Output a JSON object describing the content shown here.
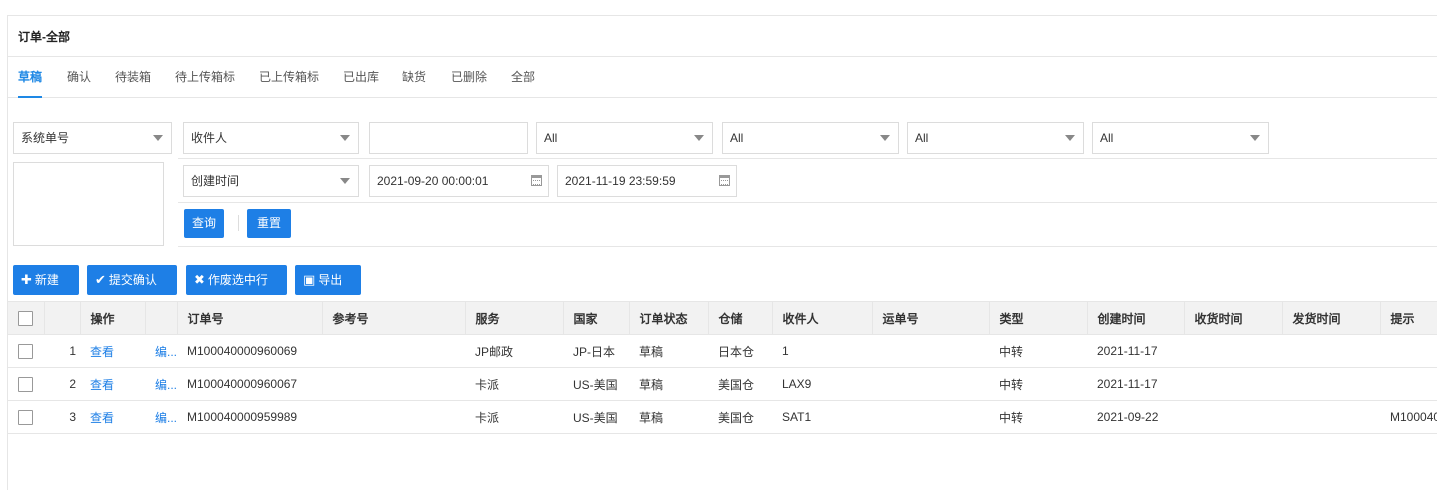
{
  "page": {
    "title": "订单-全部"
  },
  "tabs": [
    "草稿",
    "确认",
    "待装箱",
    "待上传箱标",
    "已上传箱标",
    "已出库",
    "缺货",
    "已删除",
    "全部"
  ],
  "filters": {
    "field_select": "系统单号",
    "receiver_select": "收件人",
    "search_value": "",
    "select3": "All",
    "select4": "All",
    "select5": "All",
    "select6": "All",
    "time_select": "创建时间",
    "start_time": "2021-09-20 00:00:01",
    "end_time": "2021-11-19 23:59:59",
    "query_label": "查询",
    "reset_label": "重置"
  },
  "toolbar": {
    "new_label": "新建",
    "submit_label": "提交确认",
    "void_label": "作废选中行",
    "export_label": "导出"
  },
  "table": {
    "headers": [
      "操作",
      "订单号",
      "参考号",
      "服务",
      "国家",
      "订单状态",
      "仓储",
      "收件人",
      "运单号",
      "类型",
      "创建时间",
      "收货时间",
      "发货时间",
      "提示"
    ],
    "rows": [
      {
        "idx": "1",
        "view": "查看",
        "edit": "编...",
        "order_no": "M100040000960069",
        "ref": "",
        "service": "JP邮政",
        "country": "JP-日本",
        "status": "草稿",
        "warehouse": "日本仓",
        "receiver": "1",
        "tracking": "",
        "type": "中转",
        "created": "2021-11-17",
        "received": "",
        "shipped": "",
        "tip": ""
      },
      {
        "idx": "2",
        "view": "查看",
        "edit": "编...",
        "order_no": "M100040000960067",
        "ref": "",
        "service": "卡派",
        "country": "US-美国",
        "status": "草稿",
        "warehouse": "美国仓",
        "receiver": "LAX9",
        "tracking": "",
        "type": "中转",
        "created": "2021-11-17",
        "received": "",
        "shipped": "",
        "tip": ""
      },
      {
        "idx": "3",
        "view": "查看",
        "edit": "编...",
        "order_no": "M100040000959989",
        "ref": "",
        "service": "卡派",
        "country": "US-美国",
        "status": "草稿",
        "warehouse": "美国仓",
        "receiver": "SAT1",
        "tracking": "",
        "type": "中转",
        "created": "2021-09-22",
        "received": "",
        "shipped": "",
        "tip": "M100040"
      }
    ]
  },
  "colors": {
    "accent": "#1e7fe6",
    "header_bg": "#f2f2f2"
  }
}
